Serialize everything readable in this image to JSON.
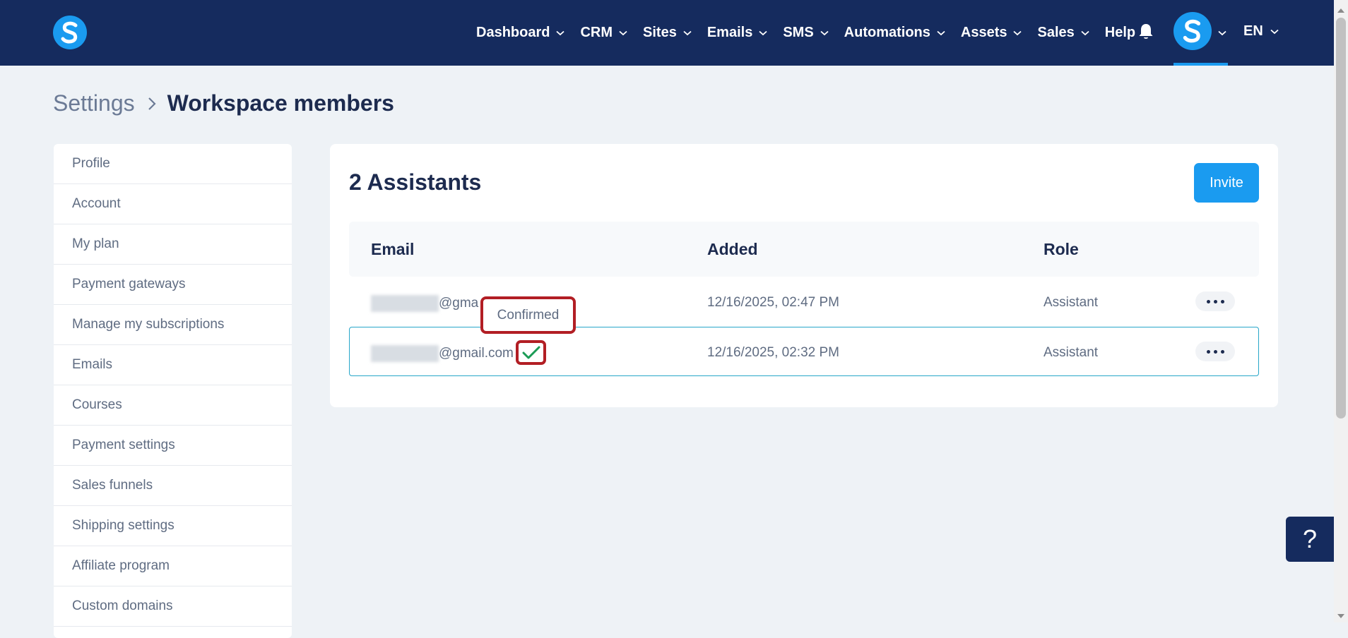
{
  "nav": {
    "items": [
      {
        "label": "Dashboard",
        "dropdown": true
      },
      {
        "label": "CRM",
        "dropdown": true
      },
      {
        "label": "Sites",
        "dropdown": true
      },
      {
        "label": "Emails",
        "dropdown": true
      },
      {
        "label": "SMS",
        "dropdown": true
      },
      {
        "label": "Automations",
        "dropdown": true
      },
      {
        "label": "Assets",
        "dropdown": true
      },
      {
        "label": "Sales",
        "dropdown": true
      },
      {
        "label": "Help",
        "dropdown": false
      }
    ],
    "language": "EN"
  },
  "breadcrumb": {
    "parent": "Settings",
    "current": "Workspace members"
  },
  "sidebar": {
    "items": [
      {
        "label": "Profile"
      },
      {
        "label": "Account"
      },
      {
        "label": "My plan"
      },
      {
        "label": "Payment gateways"
      },
      {
        "label": "Manage my subscriptions"
      },
      {
        "label": "Emails"
      },
      {
        "label": "Courses"
      },
      {
        "label": "Payment settings"
      },
      {
        "label": "Sales funnels"
      },
      {
        "label": "Shipping settings"
      },
      {
        "label": "Affiliate program"
      },
      {
        "label": "Custom domains"
      }
    ]
  },
  "main": {
    "title": "2 Assistants",
    "invite_label": "Invite",
    "table": {
      "headers": {
        "email": "Email",
        "added": "Added",
        "role": "Role"
      },
      "rows": [
        {
          "email_domain": "@gma",
          "added": "12/16/2025, 02:47 PM",
          "role": "Assistant"
        },
        {
          "email_domain": "@gmail.com",
          "added": "12/16/2025, 02:32 PM",
          "role": "Assistant"
        }
      ]
    },
    "tooltip": "Confirmed"
  },
  "help_button": "?",
  "colors": {
    "nav_bg": "#152b5e",
    "accent": "#1a9bf0",
    "highlight": "#b21e24",
    "check": "#1a9b55"
  },
  "icons": {
    "logo": "s-logo",
    "bell": "bell-icon",
    "chevron": "chevron-down-icon",
    "confirmed": "check-icon",
    "more": "more-horizontal-icon"
  }
}
